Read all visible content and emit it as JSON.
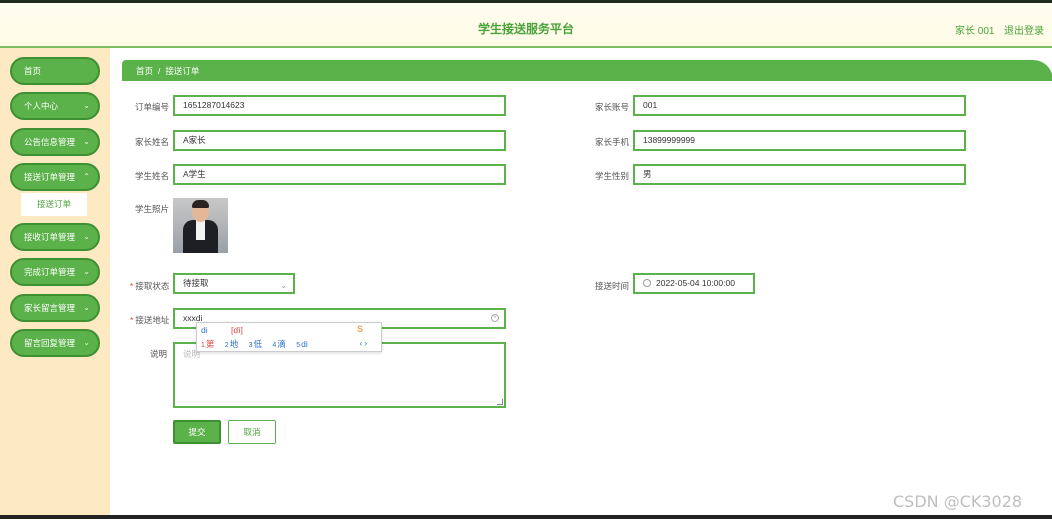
{
  "header": {
    "title": "学生接送服务平台",
    "user": "家长 001",
    "logout": "退出登录"
  },
  "sidebar": {
    "items": [
      {
        "label": "首页"
      },
      {
        "label": "个人中心"
      },
      {
        "label": "公告信息管理"
      },
      {
        "label": "接送订单管理"
      },
      {
        "label": "接收订单管理"
      },
      {
        "label": "完成订单管理"
      },
      {
        "label": "家长留言管理"
      },
      {
        "label": "留言回复管理"
      }
    ],
    "sub_item": "接送订单"
  },
  "breadcrumb": {
    "home": "首页",
    "sep": "/",
    "current": "接送订单"
  },
  "form": {
    "order_no": {
      "label": "订单编号",
      "value": "1651287014623"
    },
    "parent_account": {
      "label": "家长账号",
      "value": "001"
    },
    "parent_name": {
      "label": "家长姓名",
      "value": "A家长"
    },
    "parent_phone": {
      "label": "家长手机",
      "value": "13899999999"
    },
    "student_name": {
      "label": "学生姓名",
      "value": "A学生"
    },
    "student_gender": {
      "label": "学生性别",
      "value": "男"
    },
    "student_photo": {
      "label": "学生照片"
    },
    "pickup_status": {
      "label": "接取状态",
      "value": "待接取"
    },
    "pickup_time": {
      "label": "接送时间",
      "value": "2022-05-04 10:00:00"
    },
    "pickup_address": {
      "label": "接送地址",
      "value": "xxxdi"
    },
    "remark": {
      "label": "说明",
      "placeholder": "说明"
    },
    "required_mark": "*"
  },
  "ime": {
    "pinyin": "di",
    "pinyin_alt": "[dì]",
    "candidates": [
      {
        "n": "1",
        "text": "第"
      },
      {
        "n": "2",
        "text": "地"
      },
      {
        "n": "3",
        "text": "低"
      },
      {
        "n": "4",
        "text": "滴"
      },
      {
        "n": "5",
        "text": "di"
      }
    ],
    "nav": "‹ ›"
  },
  "buttons": {
    "submit": "提交",
    "cancel": "取消"
  },
  "watermark": "CSDN @CK3028",
  "colors": {
    "primary": "#5bb14a",
    "sidebar_bg": "#fde9c2",
    "title": "#4aa33a"
  }
}
